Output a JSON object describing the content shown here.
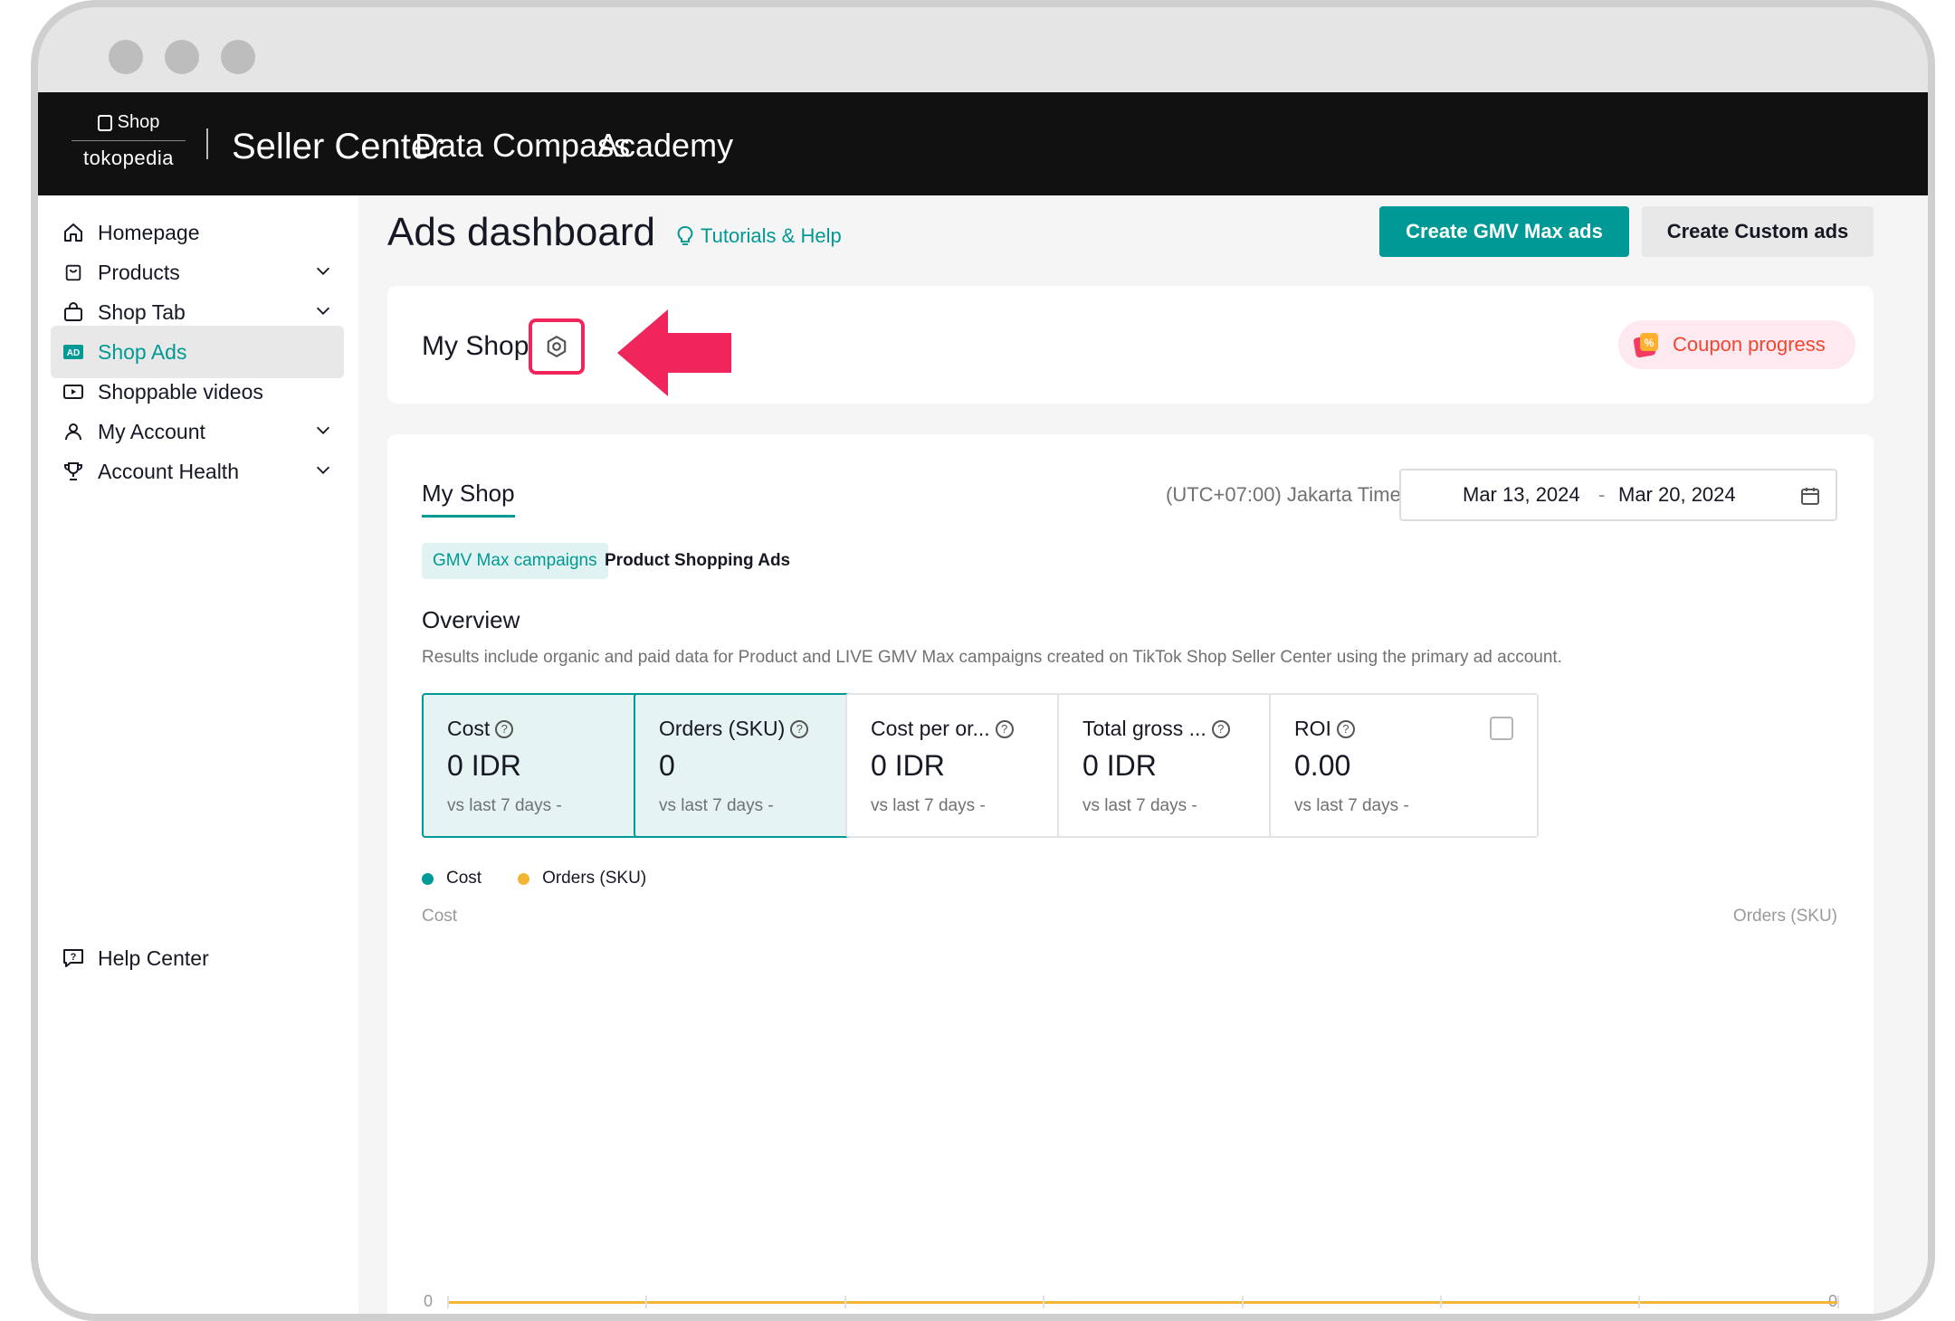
{
  "topbar": {
    "brand_shop": "Shop",
    "brand_tokopedia": "tokopedia",
    "title": "Seller Center",
    "nav": [
      "Data Compass",
      "Academy"
    ]
  },
  "sidebar": {
    "items": [
      {
        "label": "Homepage",
        "icon": "home-icon",
        "expandable": false
      },
      {
        "label": "Products",
        "icon": "bag-icon",
        "expandable": true
      },
      {
        "label": "Shop Tab",
        "icon": "shopping-bag-icon",
        "expandable": true
      },
      {
        "label": "Shop Ads",
        "icon": "ad-icon",
        "expandable": false,
        "active": true
      },
      {
        "label": "Shoppable videos",
        "icon": "video-icon",
        "expandable": false
      },
      {
        "label": "My Account",
        "icon": "user-icon",
        "expandable": true
      },
      {
        "label": "Account Health",
        "icon": "trophy-icon",
        "expandable": true
      }
    ],
    "help": "Help Center"
  },
  "header": {
    "title": "Ads dashboard",
    "tutorials": "Tutorials & Help",
    "btn_gmv": "Create GMV Max ads",
    "btn_custom": "Create Custom ads"
  },
  "shop_card": {
    "name": "My Shop",
    "coupon": "Coupon progress"
  },
  "panel": {
    "tab": "My Shop",
    "timezone": "(UTC+07:00) Jakarta Time",
    "date_start": "Mar 13, 2024",
    "date_sep": "-",
    "date_end": "Mar 20, 2024",
    "pill_active": "GMV Max campaigns",
    "pill_other": "Product Shopping Ads",
    "overview": "Overview",
    "description": "Results include organic and paid data for Product and LIVE GMV Max campaigns created on TikTok Shop Seller Center using the primary ad account."
  },
  "metrics": [
    {
      "label": "Cost",
      "value": "0 IDR",
      "compare": "vs last 7 days -",
      "checked": true
    },
    {
      "label": "Orders (SKU)",
      "value": "0",
      "compare": "vs last 7 days -",
      "checked": true
    },
    {
      "label": "Cost per or...",
      "value": "0 IDR",
      "compare": "vs last 7 days -",
      "checked": false
    },
    {
      "label": "Total gross ...",
      "value": "0 IDR",
      "compare": "vs last 7 days -",
      "checked": false
    },
    {
      "label": "ROI",
      "value": "0.00",
      "compare": "vs last 7 days -",
      "checked": false
    }
  ],
  "chart": {
    "legend": [
      {
        "name": "Cost",
        "color": "#009995"
      },
      {
        "name": "Orders (SKU)",
        "color": "#f2b632"
      }
    ],
    "left_axis": "Cost",
    "right_axis": "Orders (SKU)",
    "zero_left": "0",
    "zero_right": "0"
  },
  "colors": {
    "accent": "#009995",
    "highlight": "#f0255c",
    "coupon": "#f2462e"
  }
}
